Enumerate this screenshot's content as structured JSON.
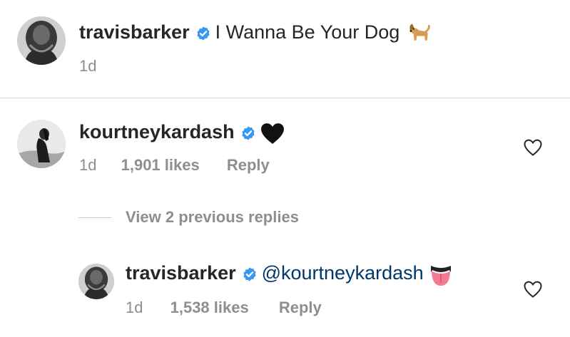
{
  "caption": {
    "username": "travisbarker",
    "text": "I Wanna Be Your Dog",
    "emoji": "dog",
    "time": "1d"
  },
  "comment": {
    "username": "kourtneykardash",
    "emoji": "black-heart",
    "time": "1d",
    "likes": "1,901 likes",
    "reply_label": "Reply"
  },
  "view_replies": {
    "label": "View 2 previous replies"
  },
  "reply": {
    "username": "travisbarker",
    "mention": "@kourtneykardash",
    "emoji": "tongue",
    "time": "1d",
    "likes": "1,538 likes",
    "reply_label": "Reply"
  },
  "colors": {
    "verified_blue": "#3897f0",
    "mention_blue": "#00376b",
    "meta_gray": "#8e8e8e",
    "divider": "#dbdbdb"
  }
}
